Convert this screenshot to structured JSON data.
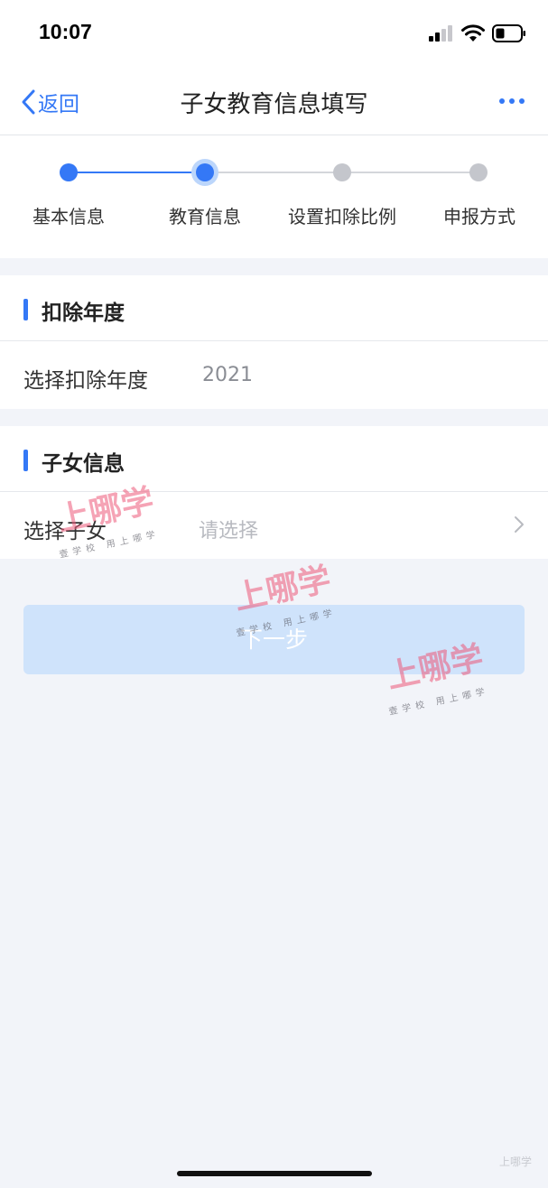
{
  "status_bar": {
    "time": "10:07"
  },
  "nav": {
    "back_label": "返回",
    "title": "子女教育信息填写"
  },
  "steps": [
    {
      "label": "基本信息",
      "state": "done"
    },
    {
      "label": "教育信息",
      "state": "current"
    },
    {
      "label": "设置扣除比例",
      "state": "pending"
    },
    {
      "label": "申报方式",
      "state": "pending"
    }
  ],
  "deduction_year": {
    "section_title": "扣除年度",
    "row_label": "选择扣除年度",
    "value": "2021"
  },
  "child_info": {
    "section_title": "子女信息",
    "row_label": "选择子女",
    "placeholder": "请选择"
  },
  "next_button": {
    "label": "下一步"
  },
  "watermark": {
    "main": "上哪学",
    "sub": "壹学校 用上哪学"
  },
  "corner_mark": "上哪学",
  "colors": {
    "accent": "#3478f6",
    "step_done": "#3478f6",
    "step_pending": "#c4c6cc",
    "button_disabled": "#cfe3fb",
    "background": "#f2f4f9"
  }
}
